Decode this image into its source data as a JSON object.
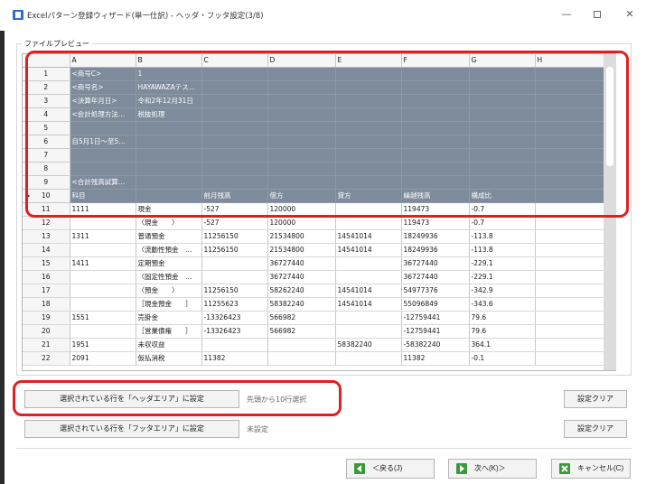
{
  "window": {
    "title": "Excelパターン登録ウィザード(単一仕訳) - ヘッダ・フッタ設定(3/8)",
    "controls": {
      "minimize": "—",
      "maximize": "",
      "close": "✕"
    }
  },
  "preview": {
    "group_label": "ファイルプレビュー",
    "columns": [
      "A",
      "B",
      "C",
      "D",
      "E",
      "F",
      "G",
      "H"
    ],
    "rows": [
      {
        "num": "1",
        "cells": [
          "<商号C>",
          "1",
          "",
          "",
          "",
          "",
          "",
          ""
        ]
      },
      {
        "num": "2",
        "cells": [
          "<商号名>",
          "HAYAWAZAテス…",
          "",
          "",
          "",
          "",
          "",
          ""
        ]
      },
      {
        "num": "3",
        "cells": [
          "<決算年月日>",
          "令和2年12月31日",
          "",
          "",
          "",
          "",
          "",
          ""
        ]
      },
      {
        "num": "4",
        "cells": [
          "<会計処理方法…",
          "税抜処理",
          "",
          "",
          "",
          "",
          "",
          ""
        ]
      },
      {
        "num": "5",
        "cells": [
          "",
          "",
          "",
          "",
          "",
          "",
          "",
          ""
        ]
      },
      {
        "num": "6",
        "cells": [
          "自5月1日～至5…",
          "",
          "",
          "",
          "",
          "",
          "",
          ""
        ]
      },
      {
        "num": "7",
        "cells": [
          "",
          "",
          "",
          "",
          "",
          "",
          "",
          ""
        ]
      },
      {
        "num": "8",
        "cells": [
          "",
          "",
          "",
          "",
          "",
          "",
          "",
          ""
        ]
      },
      {
        "num": "9",
        "cells": [
          "<合計残高試算…",
          "",
          "",
          "",
          "",
          "",
          "",
          ""
        ]
      },
      {
        "num": "10",
        "cells": [
          "科目",
          "",
          "前月残高",
          "借方",
          "貸方",
          "繰越残高",
          "構成比",
          ""
        ]
      },
      {
        "num": "11",
        "cells": [
          "1111",
          "現金",
          "-527",
          "120000",
          "",
          "119473",
          "-0.7",
          ""
        ]
      },
      {
        "num": "12",
        "cells": [
          "",
          "〈現金　　〉",
          "-527",
          "120000",
          "",
          "119473",
          "-0.7",
          ""
        ]
      },
      {
        "num": "13",
        "cells": [
          "1311",
          "普通預金",
          "11256150",
          "21534800",
          "14541014",
          "18249936",
          "-113.8",
          ""
        ]
      },
      {
        "num": "14",
        "cells": [
          "",
          "〈流動性預金　…",
          "11256150",
          "21534800",
          "14541014",
          "18249936",
          "-113.8",
          ""
        ]
      },
      {
        "num": "15",
        "cells": [
          "1411",
          "定期預金",
          "",
          "36727440",
          "",
          "36727440",
          "-229.1",
          ""
        ]
      },
      {
        "num": "16",
        "cells": [
          "",
          "〈固定性預金　…",
          "",
          "36727440",
          "",
          "36727440",
          "-229.1",
          ""
        ]
      },
      {
        "num": "17",
        "cells": [
          "",
          "〈預金　　〉",
          "11256150",
          "58262240",
          "14541014",
          "54977376",
          "-342.9",
          ""
        ]
      },
      {
        "num": "18",
        "cells": [
          "",
          "［現金預金　　］",
          "11255623",
          "58382240",
          "14541014",
          "55096849",
          "-343.6",
          ""
        ]
      },
      {
        "num": "19",
        "cells": [
          "1551",
          "売掛金",
          "-13326423",
          "566982",
          "",
          "-12759441",
          "79.6",
          ""
        ]
      },
      {
        "num": "20",
        "cells": [
          "",
          "［営業債権　　］",
          "-13326423",
          "566982",
          "",
          "-12759441",
          "79.6",
          ""
        ]
      },
      {
        "num": "21",
        "cells": [
          "1951",
          "未収収益",
          "",
          "",
          "58382240",
          "-58382240",
          "364.1",
          ""
        ]
      },
      {
        "num": "22",
        "cells": [
          "2091",
          "仮払消税",
          "11382",
          "",
          "",
          "11382",
          "-0.1",
          ""
        ]
      }
    ],
    "highlighted_rows": 10,
    "current_row": "10"
  },
  "header_row": {
    "button_label": "選択されている行を「ヘッダエリア」に設定",
    "status": "先頭から10行選択",
    "clear_label": "設定クリア"
  },
  "footer_row": {
    "button_label": "選択されている行を「フッタエリア」に設定",
    "status": "未設定",
    "clear_label": "設定クリア"
  },
  "nav": {
    "back_label": "＜戻る(J)",
    "next_label": "次へ(K)＞",
    "cancel_label": "キャンセル(C)"
  },
  "colors": {
    "selection": "#7e8b9b",
    "annotation": "#e02020",
    "nav_icon": "#3a9a3a"
  }
}
